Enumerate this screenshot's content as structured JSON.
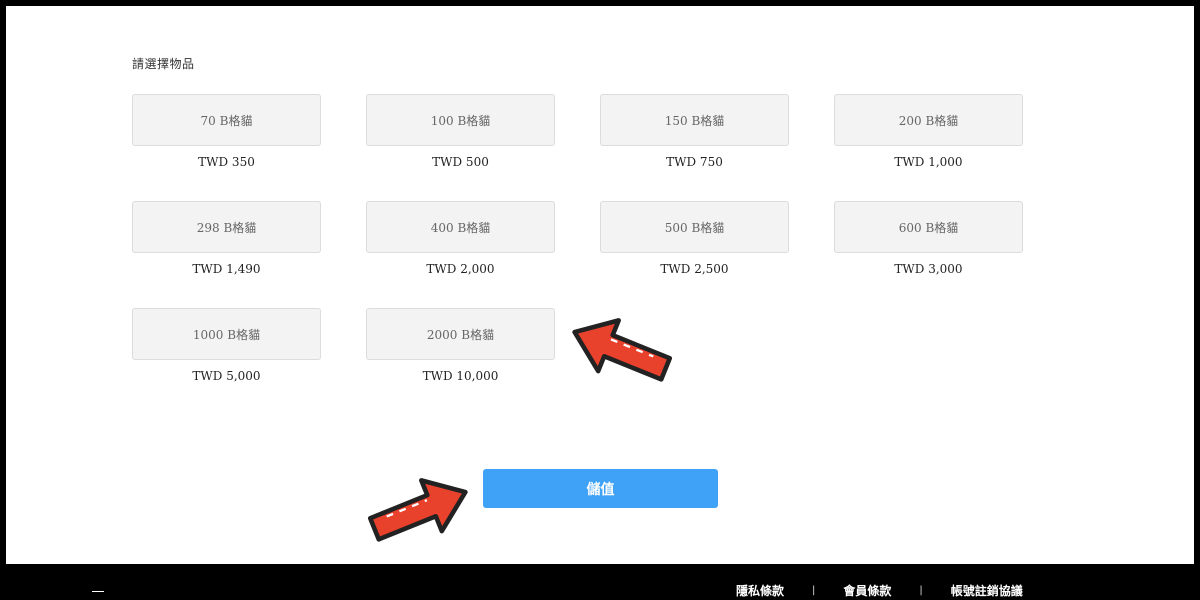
{
  "section_title": "請選擇物品",
  "items": [
    {
      "name": "70 B格貓",
      "price": "TWD 350"
    },
    {
      "name": "100 B格貓",
      "price": "TWD 500"
    },
    {
      "name": "150 B格貓",
      "price": "TWD 750"
    },
    {
      "name": "200 B格貓",
      "price": "TWD 1,000"
    },
    {
      "name": "298 B格貓",
      "price": "TWD 1,490"
    },
    {
      "name": "400 B格貓",
      "price": "TWD 2,000"
    },
    {
      "name": "500 B格貓",
      "price": "TWD 2,500"
    },
    {
      "name": "600 B格貓",
      "price": "TWD 3,000"
    },
    {
      "name": "1000 B格貓",
      "price": "TWD 5,000"
    },
    {
      "name": "2000 B格貓",
      "price": "TWD 10,000"
    }
  ],
  "submit_label": "儲值",
  "footer": {
    "links": [
      "隱私條款",
      "會員條款",
      "帳號註銷協議"
    ],
    "separator": "|"
  },
  "colors": {
    "button": "#3fa2f7",
    "arrow_fill": "#e8412c",
    "card_bg": "#f3f3f3"
  }
}
